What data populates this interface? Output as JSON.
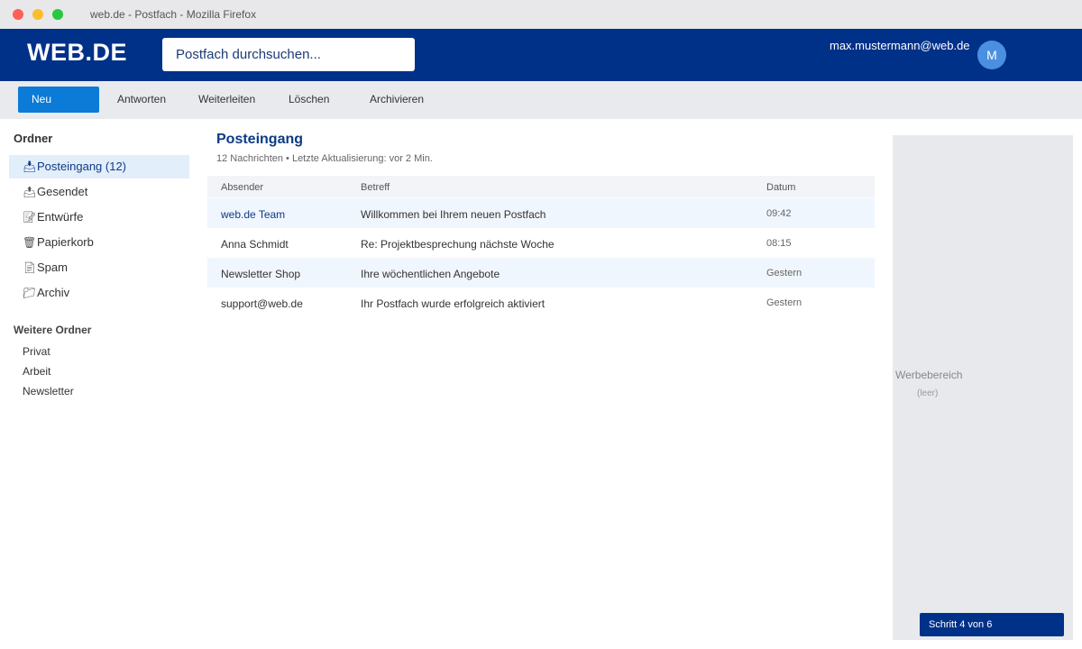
{
  "window": {
    "title": "web.de - Postfach - Mozilla Firefox"
  },
  "header": {
    "logo": "WEB.DE",
    "search_placeholder": "Postfach durchsuchen...",
    "user_email": "max.mustermann@web.de",
    "avatar_initial": "M"
  },
  "toolbar": {
    "new_label": "Neu",
    "reply_label": "Antworten",
    "forward_label": "Weiterleiten",
    "delete_label": "Löschen",
    "archive_label": "Archivieren"
  },
  "sidebar": {
    "folders_heading": "Ordner",
    "folders": [
      {
        "icon": "inbox-icon",
        "label": "Posteingang (12)"
      },
      {
        "icon": "sent-icon",
        "label": "Gesendet"
      },
      {
        "icon": "drafts-icon",
        "label": "Entwürfe"
      },
      {
        "icon": "trash-icon",
        "label": "Papierkorb"
      },
      {
        "icon": "spam-icon",
        "label": "Spam"
      },
      {
        "icon": "archive-icon",
        "label": "Archiv"
      }
    ],
    "more_heading": "Weitere Ordner",
    "more_folders": [
      "Privat",
      "Arbeit",
      "Newsletter"
    ]
  },
  "main": {
    "title": "Posteingang",
    "meta": "12 Nachrichten • Letzte Aktualisierung: vor 2 Min.",
    "columns": {
      "sender": "Absender",
      "subject": "Betreff",
      "date": "Datum"
    },
    "messages": [
      {
        "sender": "web.de Team",
        "subject": "Willkommen bei Ihrem neuen Postfach",
        "date": "09:42"
      },
      {
        "sender": "Anna Schmidt",
        "subject": "Re: Projektbesprechung nächste Woche",
        "date": "08:15"
      },
      {
        "sender": "Newsletter Shop",
        "subject": "Ihre wöchentlichen Angebote",
        "date": "Gestern"
      },
      {
        "sender": "support@web.de",
        "subject": "Ihr Postfach wurde erfolgreich aktiviert",
        "date": "Gestern"
      }
    ]
  },
  "ad": {
    "label": "Werbebereich",
    "sublabel": "(leer)"
  },
  "step": {
    "label": "Schritt 4 von 6"
  },
  "colors": {
    "brand_blue": "#003189",
    "accent_blue": "#0c7ad7"
  }
}
